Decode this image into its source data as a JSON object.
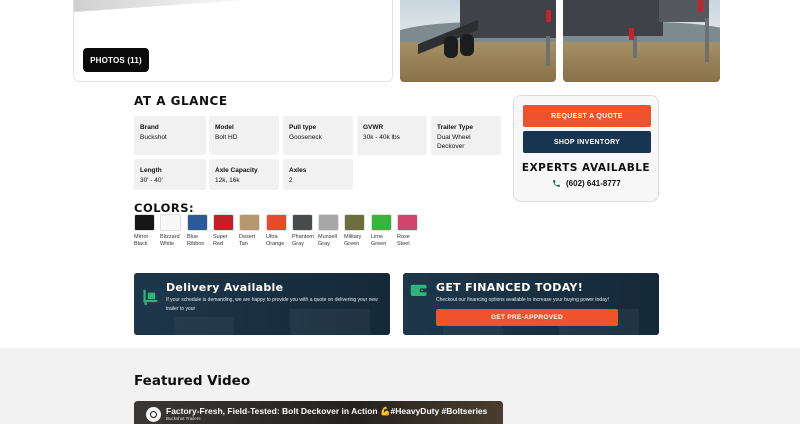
{
  "hero": {
    "photos_label": "PHOTOS (11)"
  },
  "glance": {
    "title": "AT A GLANCE",
    "specs": [
      {
        "label": "Brand",
        "value": "Buckshot"
      },
      {
        "label": "Model",
        "value": "Bolt HD"
      },
      {
        "label": "Pull type",
        "value": "Gooseneck"
      },
      {
        "label": "GVWR",
        "value": "30k - 40k lbs"
      },
      {
        "label": "Trailer Type",
        "value": "Dual Wheel Deckover"
      },
      {
        "label": "Length",
        "value": "30' - 40'"
      },
      {
        "label": "Axle Capacity",
        "value": "12k, 16k"
      },
      {
        "label": "Axles",
        "value": "2"
      }
    ]
  },
  "colors": {
    "title": "COLORS:",
    "items": [
      {
        "name": "Mirror Black",
        "hex": "#161616"
      },
      {
        "name": "Blizzard White",
        "hex": "#f7f7f7"
      },
      {
        "name": "Blue Ribbon",
        "hex": "#2c5a97"
      },
      {
        "name": "Super Red",
        "hex": "#c21f26"
      },
      {
        "name": "Desert Tan",
        "hex": "#b8976d"
      },
      {
        "name": "Ultra Orange",
        "hex": "#e8492a"
      },
      {
        "name": "Phantom Gray",
        "hex": "#4a4b4d"
      },
      {
        "name": "Munsell Gray",
        "hex": "#a7a7a7"
      },
      {
        "name": "Military Green",
        "hex": "#6c6f3c"
      },
      {
        "name": "Lime Green",
        "hex": "#3ab33d"
      },
      {
        "name": "Rose Steel",
        "hex": "#d2436e"
      }
    ]
  },
  "sidebar": {
    "quote_label": "REQUEST A QUOTE",
    "inventory_label": "SHOP INVENTORY",
    "experts_label": "EXPERTS AVAILABLE",
    "phone": "(602) 641-8777"
  },
  "delivery": {
    "title": "Delivery Available",
    "text": "If your schedule is demanding, we are happy to provide you with a quote on delivering your new trailer to your"
  },
  "finance": {
    "title": "GET FINANCED TODAY!",
    "text": "Checkout our financing options available to increase your buying power today!",
    "button_label": "GET PRE-APPROVED"
  },
  "video": {
    "section_title": "Featured Video",
    "caption": "Factory-Fresh, Field-Tested: Bolt Deckover in Action 💪#HeavyDuty #Boltseries #buckshot",
    "channel": "Buckshot Trailers"
  },
  "accent_colors": {
    "orange": "#f0532c",
    "navy": "#173552",
    "banner": "#1d3547"
  }
}
